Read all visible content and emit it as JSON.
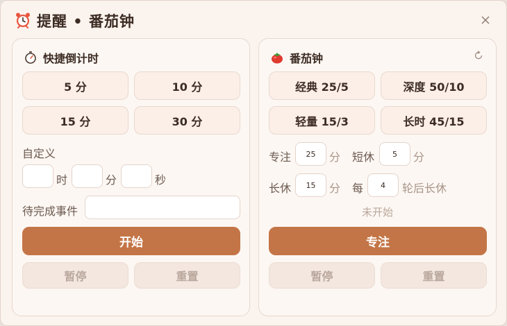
{
  "window": {
    "title": "提醒 • 番茄钟"
  },
  "quick": {
    "title": "快捷倒计时",
    "presets": [
      "5 分",
      "10 分",
      "15 分",
      "30 分"
    ],
    "custom_label": "自定义",
    "unit_hour": "时",
    "unit_min": "分",
    "unit_sec": "秒",
    "hour_value": "",
    "min_value": "",
    "sec_value": "",
    "task_label": "待完成事件",
    "task_value": "",
    "start": "开始",
    "pause": "暂停",
    "reset": "重置"
  },
  "pomodoro": {
    "title": "番茄钟",
    "presets": [
      "经典 25/5",
      "深度 50/10",
      "轻量 15/3",
      "长时 45/15"
    ],
    "focus_label": "专注",
    "focus_value": "25",
    "short_label": "短休",
    "short_value": "5",
    "long_label": "长休",
    "long_value": "15",
    "every_label": "每",
    "every_value": "4",
    "unit_min": "分",
    "rounds_suffix": "轮后长休",
    "status": "未开始",
    "start": "专注",
    "pause": "暂停",
    "reset": "重置"
  },
  "colors": {
    "accent": "#c47547",
    "background": "#fbf3ee"
  }
}
